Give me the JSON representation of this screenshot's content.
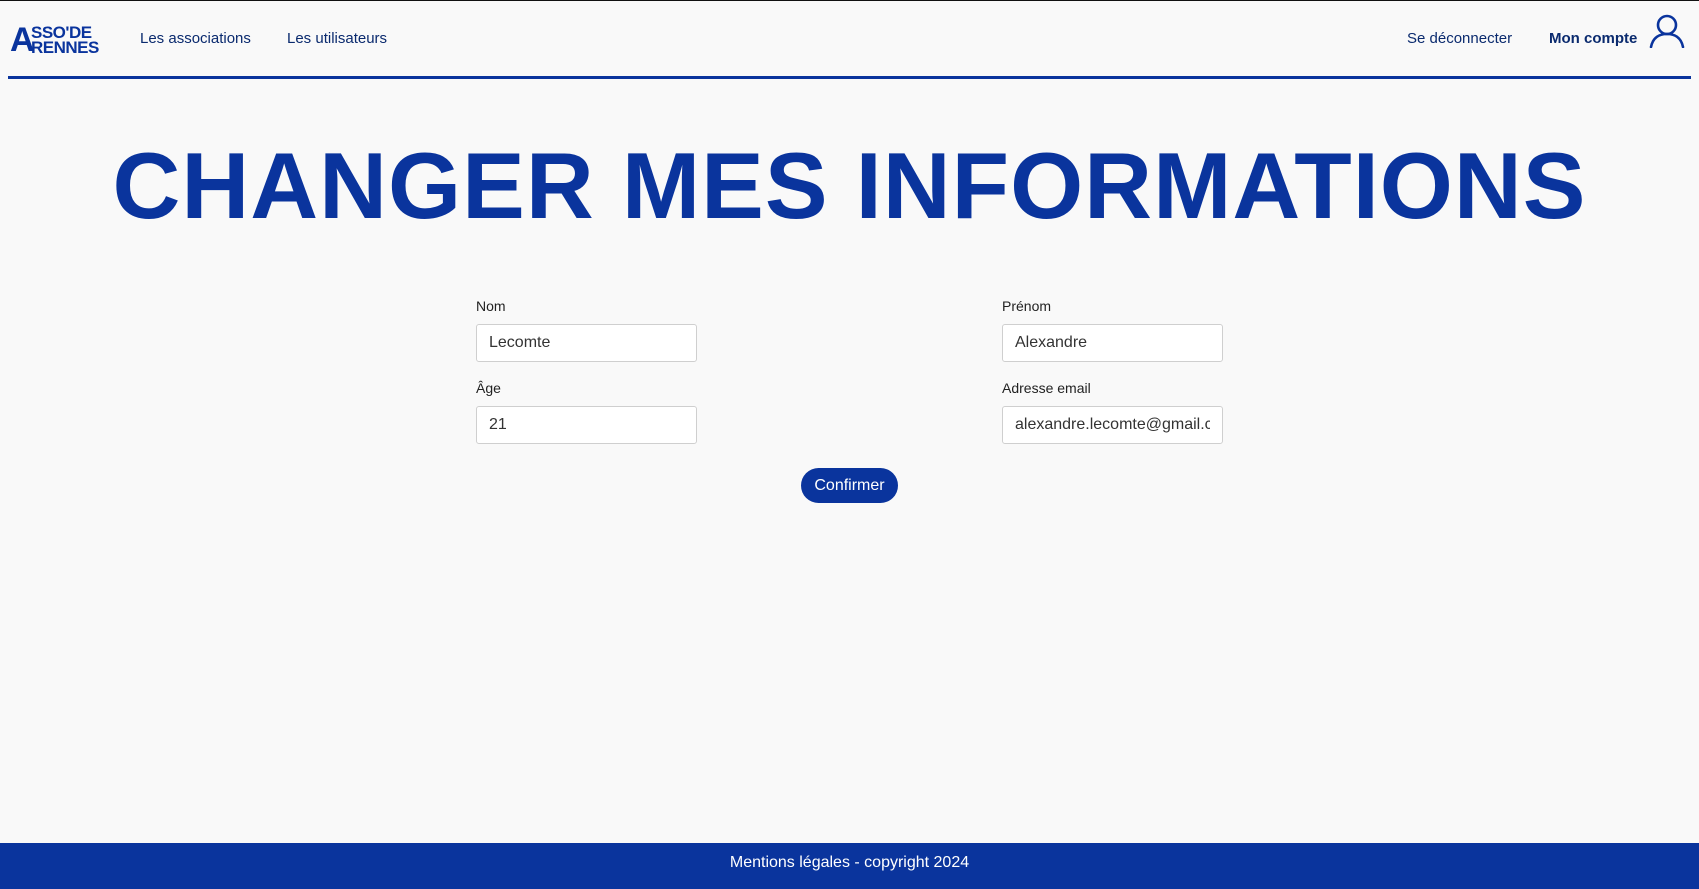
{
  "brand": {
    "logo_letter": "A",
    "logo_line1": "SSO'DE",
    "logo_line2": "RENNES",
    "primary_color": "#0a349d"
  },
  "nav": {
    "associations": "Les associations",
    "users": "Les utilisateurs",
    "logout": "Se déconnecter",
    "account": "Mon compte",
    "account_icon": "user-icon"
  },
  "main": {
    "title": "CHANGER MES INFORMATIONS"
  },
  "form": {
    "nom": {
      "label": "Nom",
      "value": "Lecomte"
    },
    "prenom": {
      "label": "Prénom",
      "value": "Alexandre"
    },
    "age": {
      "label": "Âge",
      "value": "21"
    },
    "email": {
      "label": "Adresse email",
      "value": "alexandre.lecomte@gmail.com"
    },
    "submit_label": "Confirmer"
  },
  "footer": {
    "text": "Mentions légales - copyright 2024"
  }
}
